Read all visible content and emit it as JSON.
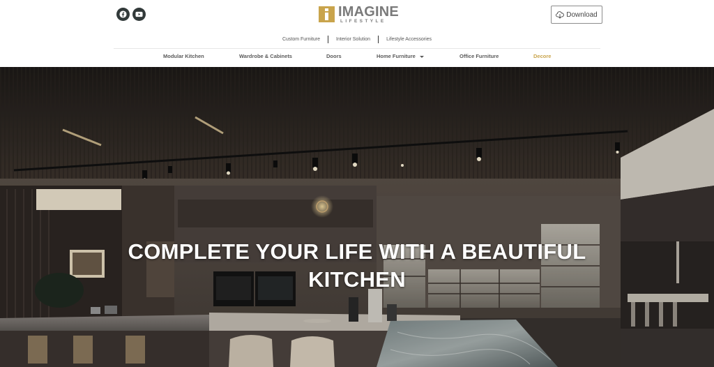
{
  "brand": {
    "name": "IMAGINE",
    "tagline": "LIFESTYLE",
    "accent_color": "#c9a44c"
  },
  "social": [
    {
      "icon": "facebook-icon"
    },
    {
      "icon": "youtube-icon"
    }
  ],
  "download": {
    "label": "Download",
    "icon": "cloud-download-icon"
  },
  "sub_nav": [
    {
      "label": "Custom Furniture"
    },
    {
      "label": "Interior Solution"
    },
    {
      "label": "Lifestyle Accessories"
    }
  ],
  "main_nav": [
    {
      "label": "Modular Kitchen"
    },
    {
      "label": "Wardrobe & Cabinets"
    },
    {
      "label": "Doors"
    },
    {
      "label": "Home Furniture",
      "has_dropdown": true
    },
    {
      "label": "Office Furniture"
    },
    {
      "label": "Decore",
      "active": true
    }
  ],
  "hero": {
    "title_line1": "COMPLETE YOUR LIFE WITH A BEAUTIFUL",
    "title_line2": "KITCHEN"
  }
}
